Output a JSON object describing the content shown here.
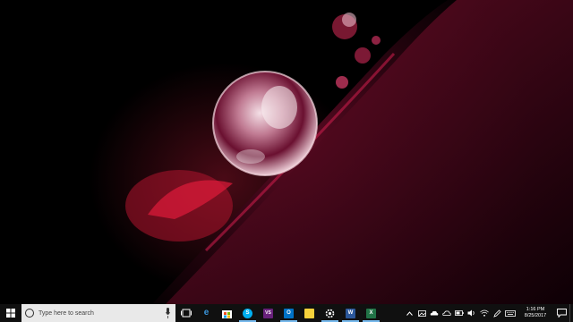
{
  "desktop": {
    "wallpaper": "red-water-droplet-macro"
  },
  "taskbar": {
    "start_icon": "windows-logo-icon",
    "search": {
      "placeholder": "Type here to search"
    },
    "clock": {
      "time": "1:16 PM",
      "date": "8/25/2017"
    },
    "apps": [
      {
        "name": "task-view",
        "label": ""
      },
      {
        "name": "edge",
        "label": "e"
      },
      {
        "name": "store",
        "label": ""
      },
      {
        "name": "skype",
        "label": "S"
      },
      {
        "name": "visual-studio",
        "label": "VS"
      },
      {
        "name": "outlook",
        "label": "O"
      },
      {
        "name": "sticky-notes",
        "label": ""
      },
      {
        "name": "settings",
        "label": ""
      },
      {
        "name": "word",
        "label": "W"
      },
      {
        "name": "excel",
        "label": "X"
      }
    ],
    "tray_icons": [
      "chevron-up-icon",
      "photos-icon",
      "onedrive-icon",
      "cloud-icon",
      "battery-icon",
      "volume-icon",
      "wifi-icon",
      "pen-icon",
      "keyboard-icon"
    ],
    "colors": {
      "accent": "#76b9ed",
      "taskbar_bg": "#101010",
      "search_bg": "#e9e9e9"
    }
  }
}
